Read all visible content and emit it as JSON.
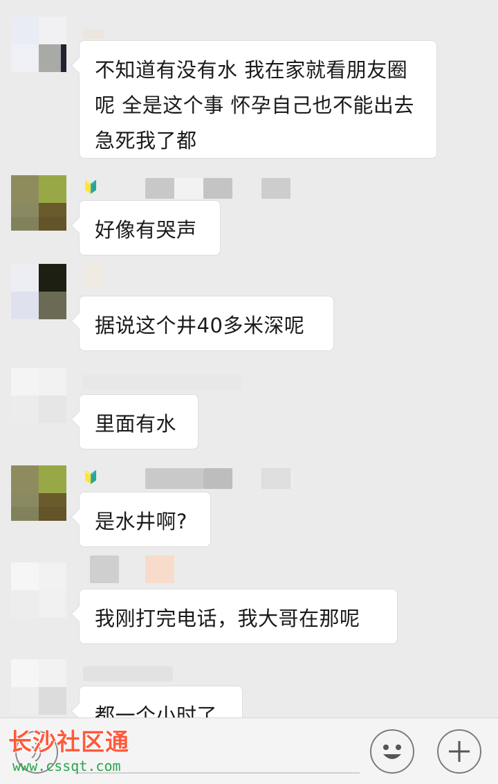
{
  "messages": [
    {
      "text": "不知道有没有水 我在家就看朋友圈呢 全是这个事 怀孕自己也不能出去 急死我了都",
      "sender_badge": ""
    },
    {
      "text": "好像有哭声",
      "sender_badge": "🔰"
    },
    {
      "text": "据说这个井40多米深呢",
      "sender_badge": ""
    },
    {
      "text": "里面有水",
      "sender_badge": ""
    },
    {
      "text": "是水井啊?",
      "sender_badge": "🔰"
    },
    {
      "text": "我刚打完电话，我大哥在那呢",
      "sender_badge": ""
    },
    {
      "text": "都一个小时了",
      "sender_badge": ""
    }
  ],
  "input_bar": {
    "voice_icon": "voice-icon",
    "emoji_icon": "emoji-icon",
    "plus_icon": "plus-icon"
  },
  "watermark": {
    "name": "长沙社区通",
    "url": "www.cssqt.com"
  },
  "colors": {
    "background": "#ebebeb",
    "bubble": "#ffffff",
    "watermark_red": "#ff5a3c",
    "watermark_green": "#26a64a"
  }
}
